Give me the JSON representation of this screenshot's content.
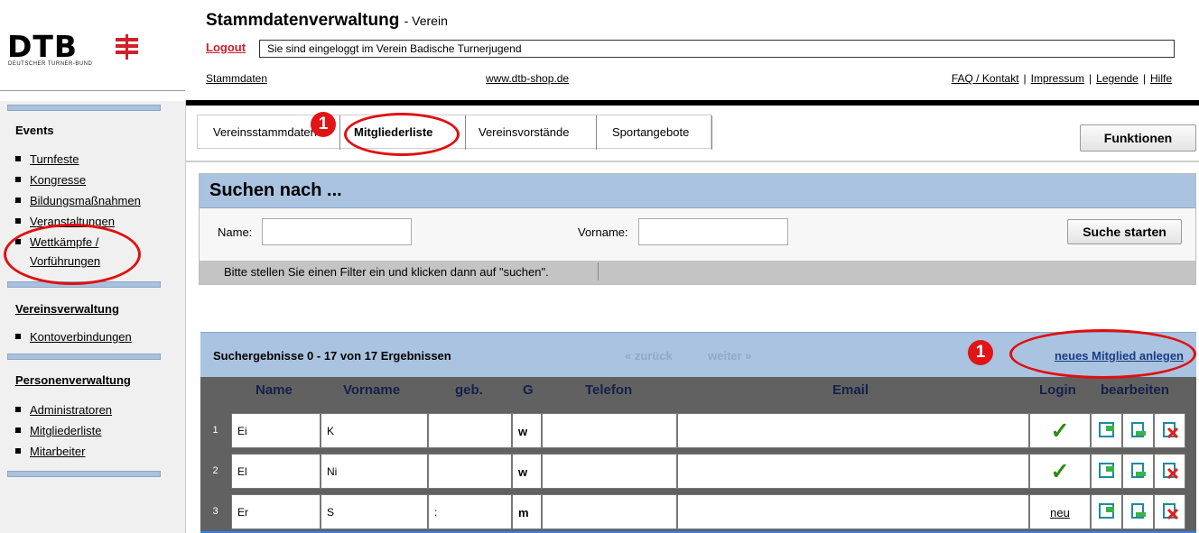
{
  "logo": {
    "text": "DTB",
    "subtitle": "DEUTSCHER TURNER-BUND"
  },
  "app": {
    "title": "Stammdatenverwaltung",
    "subtitle": "- Verein"
  },
  "header": {
    "logout": "Logout",
    "login_info": "Sie sind eingeloggt im Verein Badische Turnerjugend",
    "link_stammdaten": "Stammdaten",
    "link_shop": "www.dtb-shop.de",
    "right_links": [
      "FAQ / Kontakt",
      "Impressum",
      "Legende",
      "Hilfe"
    ],
    "separator": "|"
  },
  "sidebar": {
    "events_heading": "Events",
    "events_items": [
      "Turnfeste",
      "Kongresse",
      "Bildungsmaßnahmen",
      "Veranstaltungen",
      "Wettkämpfe /",
      "Vorführungen"
    ],
    "vereins_heading": "Vereinsverwaltung",
    "vereins_items": [
      "Kontoverbindungen"
    ],
    "personen_heading": "Personenverwaltung",
    "personen_items": [
      "Administratoren",
      "Mitgliederliste",
      "Mitarbeiter"
    ]
  },
  "tabs": [
    {
      "label": "Vereinsstammdaten",
      "active": false
    },
    {
      "label": "Mitgliederliste",
      "active": true
    },
    {
      "label": "Vereinsvorstände",
      "active": false
    },
    {
      "label": "Sportangebote",
      "active": false
    }
  ],
  "functions_button": "Funktionen",
  "search": {
    "title": "Suchen nach ...",
    "name_label": "Name:",
    "vorname_label": "Vorname:",
    "name_value": "",
    "vorname_value": "",
    "start_button": "Suche starten",
    "hint": "Bitte stellen Sie einen Filter ein und klicken dann auf \"suchen\"."
  },
  "results": {
    "title": "Suchergebnisse 0 - 17 von 17 Ergebnissen",
    "prev": "« zurück",
    "next": "weiter »",
    "new_member": "neues Mitglied anlegen",
    "columns": [
      "Name",
      "Vorname",
      "geb.",
      "G",
      "Telefon",
      "Email",
      "Login",
      "bearbeiten"
    ],
    "rows": [
      {
        "nr": "1",
        "name": "Ei",
        "vorname": "K",
        "geb": "",
        "g": "w",
        "telefon": "",
        "email": "",
        "login": "check"
      },
      {
        "nr": "2",
        "name": "El",
        "vorname": "Ni",
        "geb": "",
        "g": "w",
        "telefon": "",
        "email": "",
        "login": "check"
      },
      {
        "nr": "3",
        "name": "Er",
        "vorname": "S",
        "geb": ":",
        "g": "m",
        "telefon": "",
        "email": "",
        "login": "neu"
      }
    ]
  },
  "annotations": {
    "marker_1": "1",
    "marker_2": "1"
  },
  "colors": {
    "accent_red": "#e01010",
    "panel_blue": "#a9c3e0",
    "check_green": "#2e8b0e",
    "logo_red": "#d0202a"
  },
  "icons": [
    "dtb-logo-icon",
    "edit-member-icon",
    "print-member-icon",
    "delete-member-icon",
    "checkmark-icon"
  ]
}
